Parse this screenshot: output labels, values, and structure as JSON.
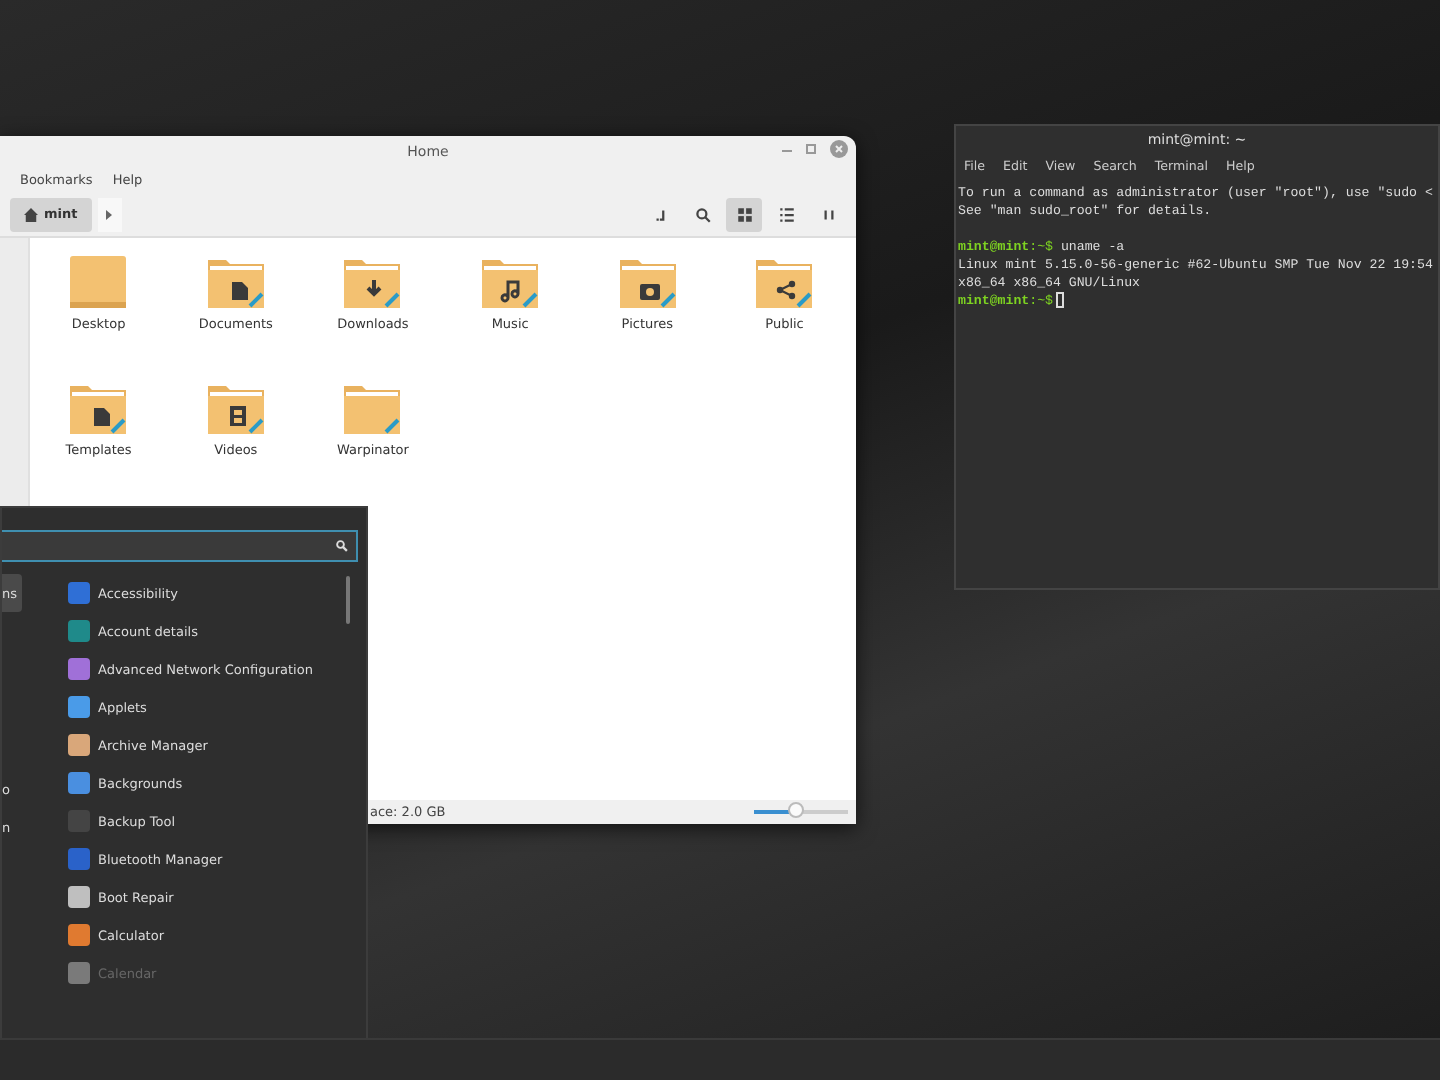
{
  "file_manager": {
    "title": "Home",
    "menu": [
      "Bookmarks",
      "Help"
    ],
    "path": [
      {
        "label": "mint",
        "selected": true
      }
    ],
    "view_buttons": [
      {
        "kind": "location",
        "selected": false
      },
      {
        "kind": "search",
        "selected": false
      },
      {
        "kind": "grid",
        "selected": true
      },
      {
        "kind": "list",
        "selected": false
      },
      {
        "kind": "compact",
        "selected": false
      }
    ],
    "folders": [
      {
        "name": "Desktop",
        "kind": "plain"
      },
      {
        "name": "Documents",
        "kind": "document"
      },
      {
        "name": "Downloads",
        "kind": "download"
      },
      {
        "name": "Music",
        "kind": "music"
      },
      {
        "name": "Pictures",
        "kind": "camera"
      },
      {
        "name": "Public",
        "kind": "share"
      },
      {
        "name": "Templates",
        "kind": "document"
      },
      {
        "name": "Videos",
        "kind": "video"
      },
      {
        "name": "Warpinator",
        "kind": "blank"
      }
    ],
    "status": "ace: 2.0 GB",
    "zoom": {
      "level": 0.45
    }
  },
  "app_menu": {
    "categories": [
      {
        "label": "ns",
        "selected": true
      },
      {
        "label": "o",
        "selected": false
      },
      {
        "label": "n",
        "selected": false
      }
    ],
    "apps": [
      {
        "name": "Accessibility",
        "color": "#2f6fd6",
        "disabled": false
      },
      {
        "name": "Account details",
        "color": "#1f8a8a",
        "disabled": false
      },
      {
        "name": "Advanced Network Configuration",
        "color": "#a070d8",
        "disabled": false
      },
      {
        "name": "Applets",
        "color": "#4a9be8",
        "disabled": false
      },
      {
        "name": "Archive Manager",
        "color": "#d9a77a",
        "disabled": false
      },
      {
        "name": "Backgrounds",
        "color": "#4a8fe0",
        "disabled": false
      },
      {
        "name": "Backup Tool",
        "color": "#444444",
        "disabled": false
      },
      {
        "name": "Bluetooth Manager",
        "color": "#2a62c9",
        "disabled": false
      },
      {
        "name": "Boot Repair",
        "color": "#bfbfbf",
        "disabled": false
      },
      {
        "name": "Calculator",
        "color": "#e07a30",
        "disabled": false
      },
      {
        "name": "Calendar",
        "color": "#7a7a7a",
        "disabled": true
      }
    ]
  },
  "terminal": {
    "title": "mint@mint: ~",
    "menu": [
      "File",
      "Edit",
      "View",
      "Search",
      "Terminal",
      "Help"
    ],
    "lines": [
      {
        "kind": "output",
        "text": "To run a command as administrator (user \"root\"), use \"sudo <"
      },
      {
        "kind": "output",
        "text": "See \"man sudo_root\" for details."
      },
      {
        "kind": "blank"
      },
      {
        "kind": "prompt",
        "user": "mint@mint",
        "path": ":~$",
        "command": "uname -a"
      },
      {
        "kind": "output",
        "text": "Linux mint 5.15.0-56-generic #62-Ubuntu SMP Tue Nov 22 19:54"
      },
      {
        "kind": "output",
        "text": "x86_64 x86_64 GNU/Linux"
      },
      {
        "kind": "prompt",
        "user": "mint@mint",
        "path": ":~$",
        "cursor": true
      }
    ]
  }
}
